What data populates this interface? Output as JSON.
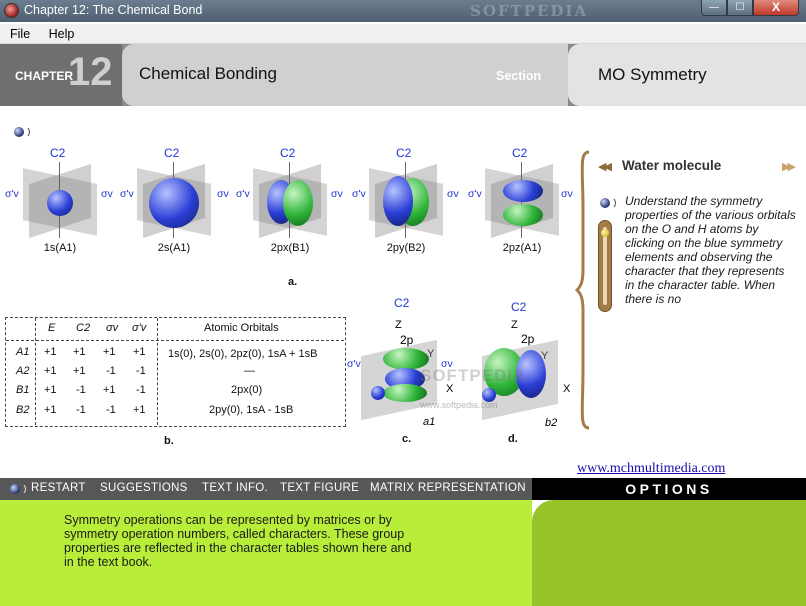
{
  "window": {
    "title": "Chapter 12: The Chemical Bond",
    "watermark": "SOFTPEDIA",
    "controls": {
      "minimize": "—",
      "maximize": "☐",
      "close": "X"
    }
  },
  "menu": {
    "file": "File",
    "help": "Help"
  },
  "header": {
    "chapter_label": "CHAPTER",
    "chapter_number": "12",
    "topic": "Chemical Bonding",
    "section_label": "Section",
    "section_title": "MO Symmetry"
  },
  "figure_a": {
    "caption": "a.",
    "axis_label": "C2",
    "sigma_v_prime": "σ'v",
    "sigma_v": "σv",
    "orbitals": [
      {
        "label": "1s(A1)"
      },
      {
        "label": "2s(A1)"
      },
      {
        "label": "2px(B1)"
      },
      {
        "label": "2py(B2)"
      },
      {
        "label": "2pz(A1)"
      }
    ]
  },
  "table": {
    "caption": "b.",
    "headers": [
      "E",
      "C2",
      "σv",
      "σ'v",
      "Atomic Orbitals"
    ],
    "rows": [
      {
        "sym": "A1",
        "vals": [
          "+1",
          "+1",
          "+1",
          "+1"
        ],
        "orbitals": "1s(0),  2s(0),  2pz(0),  1sA + 1sB"
      },
      {
        "sym": "A2",
        "vals": [
          "+1",
          "+1",
          "-1",
          "-1"
        ],
        "orbitals": "—"
      },
      {
        "sym": "B1",
        "vals": [
          "+1",
          "-1",
          "+1",
          "-1"
        ],
        "orbitals": "2px(0)"
      },
      {
        "sym": "B2",
        "vals": [
          "+1",
          "-1",
          "-1",
          "+1"
        ],
        "orbitals": "2py(0),  1sA - 1sB"
      }
    ]
  },
  "figure_c": {
    "caption": "c.",
    "c2": "C2",
    "z": "Z",
    "y": "Y",
    "x": "X",
    "p": "2p",
    "sv": "σv",
    "svp": "σ'v",
    "mo": "a1"
  },
  "figure_d": {
    "caption": "d.",
    "c2": "C2",
    "z": "Z",
    "y": "Y",
    "x": "X",
    "p": "2p",
    "mo": "b2"
  },
  "watermark_overlay": {
    "main": "SOFTPEDIA",
    "sub": "www.softpedia.com"
  },
  "side_panel": {
    "title": "Water molecule",
    "text": "Understand the symmetry properties of the various orbitals on the O and H atoms by clicking on the blue symmetry elements and observing the character that they represents in the character table.  When there is no",
    "link": "www.mchmultimedia.com",
    "colors": {
      "accent": "#a47c48"
    }
  },
  "nav": {
    "restart": "RESTART",
    "suggestions": "SUGGESTIONS",
    "text_info": "TEXT INFO.",
    "text_figure": "TEXT FIGURE",
    "matrix": "MATRIX REPRESENTATION",
    "options": "OPTIONS"
  },
  "footer": {
    "text": "Symmetry operations can be represented by matrices or by symmetry operation numbers, called characters. These group properties are reflected in the character tables shown here and in the text book."
  }
}
